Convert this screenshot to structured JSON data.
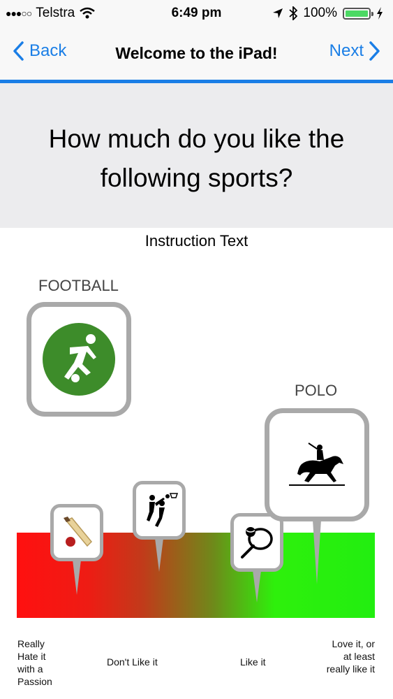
{
  "status_bar": {
    "carrier": "Telstra",
    "time": "6:49 pm",
    "battery": "100%"
  },
  "nav": {
    "back_label": "Back",
    "title": "Welcome to the iPad!",
    "next_label": "Next"
  },
  "question": "How much do you like the following sports?",
  "instruction": "Instruction Text",
  "sports": {
    "football_label": "FOOTBALL",
    "polo_label": "POLO"
  },
  "scale_labels": {
    "l1": "Really Hate it with a Passion",
    "l2": "Don't Like it",
    "l3": "Like it",
    "l4": "Love it, or at least really like it"
  },
  "colors": {
    "accent": "#1a7ee6",
    "football_green": "#3d8c2a",
    "scale_red": "#ff1010",
    "scale_green": "#22ee10"
  }
}
